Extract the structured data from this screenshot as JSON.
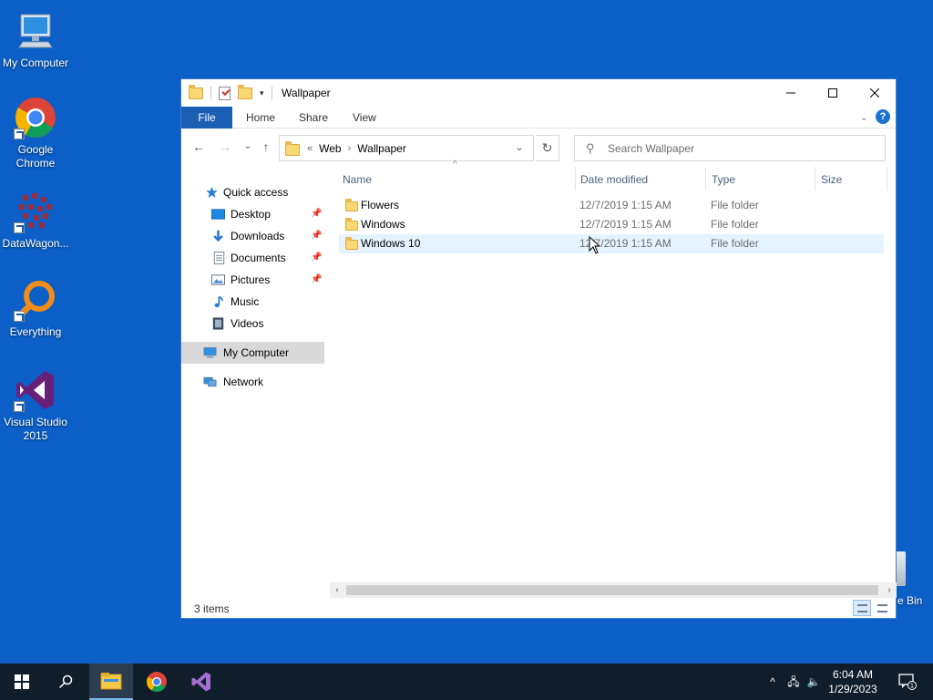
{
  "desktop": {
    "icons": [
      {
        "label": "My Computer",
        "icon": "computer-icon"
      },
      {
        "label": "Google Chrome",
        "icon": "chrome-icon"
      },
      {
        "label": "DataWagon...",
        "icon": "datawagon-icon"
      },
      {
        "label": "Everything",
        "icon": "everything-search-icon"
      },
      {
        "label": "Visual Studio 2015",
        "icon": "visual-studio-icon"
      }
    ],
    "recycle_bin_label": "e Bin"
  },
  "window": {
    "title": "Wallpaper",
    "controls": {
      "minimize": "—",
      "maximize": "☐",
      "close": "✕"
    },
    "ribbon_tabs": [
      "File",
      "Home",
      "Share",
      "View"
    ],
    "address": {
      "breadcrumb": [
        "Web",
        "Wallpaper"
      ],
      "overflow": "«"
    },
    "search_placeholder": "Search Wallpaper",
    "nav_pane": [
      {
        "label": "Quick access",
        "icon": "star-icon",
        "pinned": false
      },
      {
        "label": "Desktop",
        "icon": "desktop-icon",
        "pinned": true
      },
      {
        "label": "Downloads",
        "icon": "download-icon",
        "pinned": true
      },
      {
        "label": "Documents",
        "icon": "documents-icon",
        "pinned": true
      },
      {
        "label": "Pictures",
        "icon": "pictures-icon",
        "pinned": true
      },
      {
        "label": "Music",
        "icon": "music-icon",
        "pinned": false
      },
      {
        "label": "Videos",
        "icon": "videos-icon",
        "pinned": false
      },
      {
        "label": "My Computer",
        "icon": "computer-icon",
        "pinned": false,
        "selected": true
      },
      {
        "label": "Network",
        "icon": "network-icon",
        "pinned": false
      }
    ],
    "columns": [
      "Name",
      "Date modified",
      "Type",
      "Size"
    ],
    "files": [
      {
        "name": "Flowers",
        "date": "12/7/2019 1:15 AM",
        "type": "File folder",
        "size": ""
      },
      {
        "name": "Windows",
        "date": "12/7/2019 1:15 AM",
        "type": "File folder",
        "size": ""
      },
      {
        "name": "Windows 10",
        "date": "12/7/2019 1:15 AM",
        "type": "File folder",
        "size": "",
        "hovered": true
      }
    ],
    "status": "3 items"
  },
  "taskbar": {
    "apps": [
      "start-icon",
      "search-icon",
      "file-explorer-icon",
      "chrome-icon",
      "visual-studio-icon"
    ],
    "active_app": "file-explorer-icon",
    "time": "6:04 AM",
    "date": "1/29/2023",
    "notification_count": "1"
  },
  "colors": {
    "desktop": "#0b5fc6",
    "accent": "#1a5fb4",
    "taskbar": "#101d2b",
    "hover_row": "#e5f3ff",
    "selected_nav": "#d9d9d9"
  }
}
